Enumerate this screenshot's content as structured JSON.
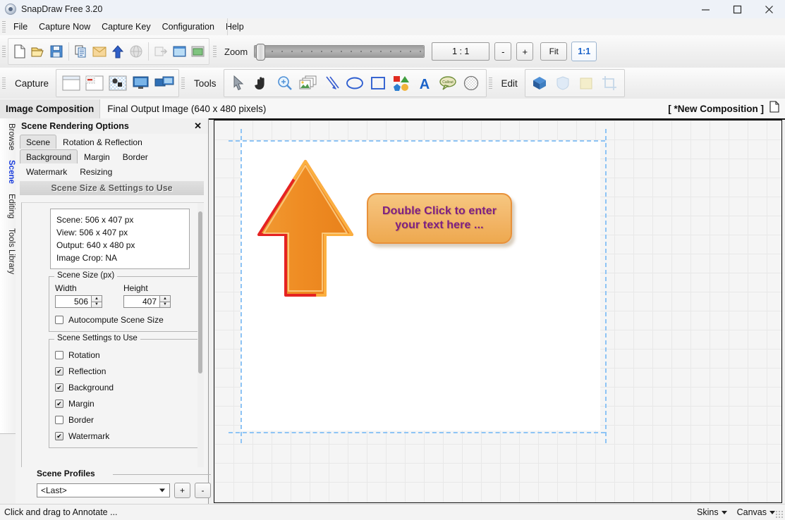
{
  "window": {
    "title": "SnapDraw Free 3.20",
    "app_icon": "app-logo-icon",
    "minimize": "─",
    "maximize": "□",
    "close": "✕"
  },
  "menubar": {
    "items": [
      {
        "label": "File"
      },
      {
        "label": "Capture Now"
      },
      {
        "label": "Capture Key"
      },
      {
        "label": "Configuration"
      },
      {
        "label": "Help"
      }
    ]
  },
  "toolbar_file": {
    "icons": [
      {
        "name": "new-document-icon"
      },
      {
        "name": "open-folder-icon"
      },
      {
        "name": "save-icon"
      },
      {
        "name": "copy-icon"
      },
      {
        "name": "mail-icon"
      },
      {
        "name": "upload-arrow-icon"
      },
      {
        "name": "globe-icon"
      },
      {
        "name": "export-icon"
      },
      {
        "name": "window-icon"
      },
      {
        "name": "image-window-icon"
      }
    ]
  },
  "zoom": {
    "label": "Zoom",
    "ratio_value": "1 : 1",
    "minus_label": "-",
    "plus_label": "+",
    "fit_label": "Fit",
    "one_to_one_label": "1:1",
    "slider_position_percent": 2
  },
  "capture": {
    "label": "Capture",
    "icons": [
      {
        "name": "capture-window-icon"
      },
      {
        "name": "capture-region-icon"
      },
      {
        "name": "capture-transparent-icon"
      },
      {
        "name": "capture-screen-icon"
      },
      {
        "name": "capture-multi-screen-icon"
      }
    ]
  },
  "tools": {
    "label": "Tools",
    "icons": [
      {
        "name": "pointer-tool-icon"
      },
      {
        "name": "hand-pan-tool-icon"
      },
      {
        "name": "magnifier-zoom-tool-icon"
      },
      {
        "name": "images-tool-icon"
      },
      {
        "name": "arrow-line-tool-icon"
      },
      {
        "name": "ellipse-tool-icon"
      },
      {
        "name": "rectangle-tool-icon"
      },
      {
        "name": "shapes-tool-icon"
      },
      {
        "name": "text-tool-icon"
      },
      {
        "name": "callout-tool-icon"
      },
      {
        "name": "blur-tool-icon"
      }
    ]
  },
  "edit": {
    "label": "Edit",
    "icons": [
      {
        "name": "object-3d-icon"
      },
      {
        "name": "shield-icon"
      },
      {
        "name": "note-icon"
      },
      {
        "name": "crop-icon"
      }
    ]
  },
  "composition_bar": {
    "tab_label": "Image Composition",
    "subtitle": "Final Output Image (640 x 480 pixels)",
    "composition_name": "[ *New Composition ]",
    "doc_icon": "document-icon"
  },
  "vertical_tabs": [
    {
      "label": "Browse",
      "active": false
    },
    {
      "label": "Scene",
      "active": true
    },
    {
      "label": "Editing",
      "active": false
    },
    {
      "label": "Tools Library",
      "active": false
    }
  ],
  "panel": {
    "title": "Scene Rendering Options",
    "close_label": "✕",
    "tabs_row1": [
      {
        "label": "Scene",
        "selected": true
      },
      {
        "label": "Rotation & Reflection",
        "selected": false
      }
    ],
    "tabs_row2": [
      {
        "label": "Background",
        "selected": true
      },
      {
        "label": "Margin",
        "selected": false
      },
      {
        "label": "Border",
        "selected": false
      }
    ],
    "tabs_row3": [
      {
        "label": "Watermark",
        "selected": false
      },
      {
        "label": "Resizing",
        "selected": false
      }
    ],
    "banner": "Scene Size & Settings to Use",
    "info": {
      "scene": "Scene: 506 x 407 px",
      "view": "View: 506 x 407 px",
      "output": "Output: 640 x 480 px",
      "crop": "Image Crop: NA"
    },
    "scene_size": {
      "legend": "Scene Size (px)",
      "width_label": "Width",
      "width_value": "506",
      "height_label": "Height",
      "height_value": "407",
      "autocompute_label": "Autocompute Scene Size",
      "autocompute_checked": false
    },
    "scene_settings": {
      "legend": "Scene Settings to Use",
      "options": [
        {
          "label": "Rotation",
          "checked": false
        },
        {
          "label": "Reflection",
          "checked": true
        },
        {
          "label": "Background",
          "checked": true
        },
        {
          "label": "Margin",
          "checked": true
        },
        {
          "label": "Border",
          "checked": false
        },
        {
          "label": "Watermark",
          "checked": true
        }
      ]
    },
    "profiles": {
      "legend": "Scene Profiles",
      "selected": "<Last>",
      "add_label": "+",
      "remove_label": "-"
    }
  },
  "canvas": {
    "arrow": {
      "name": "up-arrow-shape",
      "fill": "#ef8c23",
      "stroke_top": "#fbb040",
      "stroke_bottom": "#e52322"
    },
    "text_shape": {
      "name": "text-callout-shape",
      "text_line1": "Double Click to enter",
      "text_line2": "your text here ...",
      "text_color": "#7d1f84",
      "fill": "#f2b567",
      "border": "#e8913a"
    },
    "guide_color": "#8ec4f5"
  },
  "statusbar": {
    "message": "Click and drag to Annotate ...",
    "skins_label": "Skins",
    "canvas_label": "Canvas"
  }
}
